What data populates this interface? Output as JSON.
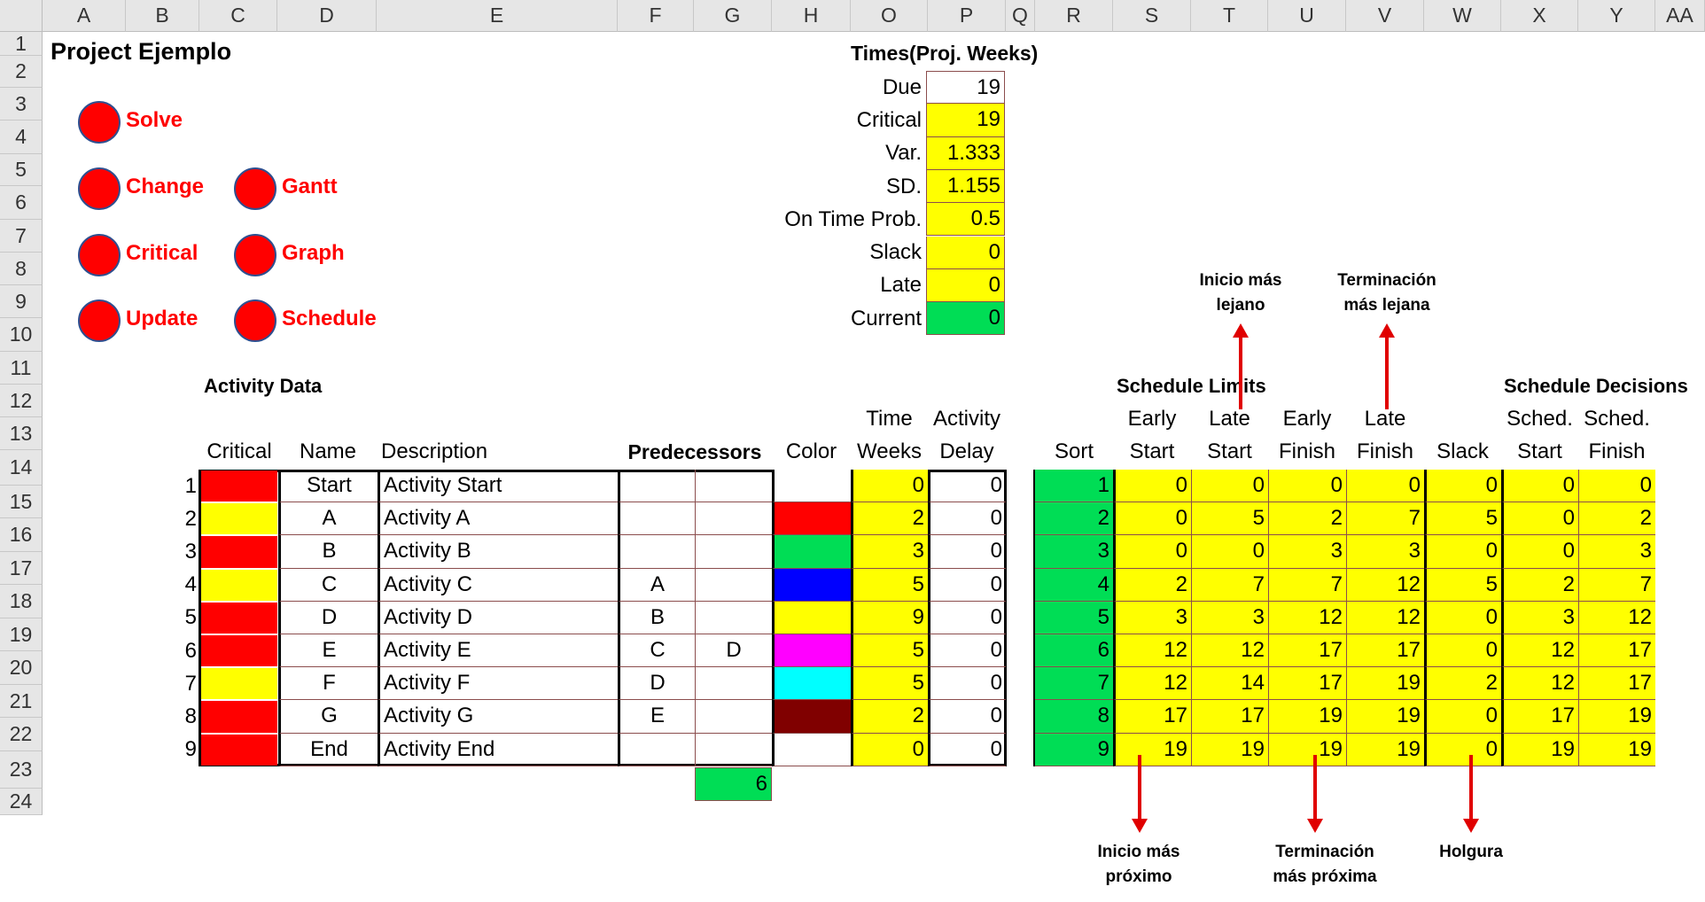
{
  "columns": [
    "A",
    "B",
    "C",
    "D",
    "E",
    "F",
    "G",
    "H",
    "O",
    "P",
    "Q",
    "R",
    "S",
    "T",
    "U",
    "V",
    "W",
    "X",
    "Y",
    "AA"
  ],
  "rows": [
    "1",
    "2",
    "3",
    "4",
    "5",
    "6",
    "7",
    "8",
    "9",
    "10",
    "11",
    "12",
    "13",
    "14",
    "15",
    "16",
    "17",
    "18",
    "19",
    "20",
    "21",
    "22",
    "23",
    "24"
  ],
  "title": "Project Ejemplo",
  "buttons": [
    "Solve",
    "Change",
    "Gantt",
    "Critical",
    "Graph",
    "Update",
    "Schedule"
  ],
  "times": {
    "header": "Times(Proj. Weeks)",
    "labels": [
      "Due",
      "Critical",
      "Var.",
      "SD.",
      "On Time Prob.",
      "Slack",
      "Late",
      "Current"
    ],
    "values": [
      "19",
      "19",
      "1.333",
      "1.155",
      "0.5",
      "0",
      "0",
      "0"
    ]
  },
  "activity": {
    "section": "Activity Data",
    "h_critical": "Critical",
    "h_name": "Name",
    "h_desc": "Description",
    "h_pred": "Predecessors",
    "h_color": "Color",
    "h_time1": "Time",
    "h_time2": "Weeks",
    "h_delay1": "Activity",
    "h_delay2": "Delay",
    "rows": [
      {
        "num": "1",
        "name": "Start",
        "desc": "Activity Start",
        "p1": "",
        "p2": "",
        "time": "0",
        "delay": "0"
      },
      {
        "num": "2",
        "name": "A",
        "desc": "Activity A",
        "p1": "",
        "p2": "",
        "time": "2",
        "delay": "0"
      },
      {
        "num": "3",
        "name": "B",
        "desc": "Activity B",
        "p1": "",
        "p2": "",
        "time": "3",
        "delay": "0"
      },
      {
        "num": "4",
        "name": "C",
        "desc": "Activity C",
        "p1": "A",
        "p2": "",
        "time": "5",
        "delay": "0"
      },
      {
        "num": "5",
        "name": "D",
        "desc": "Activity D",
        "p1": "B",
        "p2": "",
        "time": "9",
        "delay": "0"
      },
      {
        "num": "6",
        "name": "E",
        "desc": "Activity E",
        "p1": "C",
        "p2": "D",
        "time": "5",
        "delay": "0"
      },
      {
        "num": "7",
        "name": "F",
        "desc": "Activity F",
        "p1": "D",
        "p2": "",
        "time": "5",
        "delay": "0"
      },
      {
        "num": "8",
        "name": "G",
        "desc": "Activity G",
        "p1": "E",
        "p2": "",
        "time": "2",
        "delay": "0"
      },
      {
        "num": "9",
        "name": "End",
        "desc": "Activity End",
        "p1": "",
        "p2": "",
        "time": "0",
        "delay": "0"
      }
    ],
    "critical_colors": [
      "#ff0000",
      "#ffff00",
      "#ff0000",
      "#ffff00",
      "#ff0000",
      "#ff0000",
      "#ffff00",
      "#ff0000",
      "#ff0000"
    ],
    "activity_colors": [
      "#ffffff",
      "#ff0000",
      "#00dd55",
      "#0000ff",
      "#ffff00",
      "#ff00ff",
      "#00ffff",
      "#800000",
      "#ffffff"
    ],
    "g23": "6"
  },
  "schedule": {
    "limits_title": "Schedule Limits",
    "decisions_title": "Schedule Decisions",
    "h_sort": "Sort",
    "h_es1": "Early",
    "h_es2": "Start",
    "h_ls1": "Late",
    "h_ls2": "Start",
    "h_ef1": "Early",
    "h_ef2": "Finish",
    "h_lf1": "Late",
    "h_lf2": "Finish",
    "h_slack": "Slack",
    "h_ss1": "Sched.",
    "h_ss2": "Start",
    "h_sf1": "Sched.",
    "h_sf2": "Finish",
    "rows": [
      {
        "sort": "1",
        "es": "0",
        "ls": "0",
        "ef": "0",
        "lf": "0",
        "slack": "0",
        "ss": "0",
        "sf": "0"
      },
      {
        "sort": "2",
        "es": "0",
        "ls": "5",
        "ef": "2",
        "lf": "7",
        "slack": "5",
        "ss": "0",
        "sf": "2"
      },
      {
        "sort": "3",
        "es": "0",
        "ls": "0",
        "ef": "3",
        "lf": "3",
        "slack": "0",
        "ss": "0",
        "sf": "3"
      },
      {
        "sort": "4",
        "es": "2",
        "ls": "7",
        "ef": "7",
        "lf": "12",
        "slack": "5",
        "ss": "2",
        "sf": "7"
      },
      {
        "sort": "5",
        "es": "3",
        "ls": "3",
        "ef": "12",
        "lf": "12",
        "slack": "0",
        "ss": "3",
        "sf": "12"
      },
      {
        "sort": "6",
        "es": "12",
        "ls": "12",
        "ef": "17",
        "lf": "17",
        "slack": "0",
        "ss": "12",
        "sf": "17"
      },
      {
        "sort": "7",
        "es": "12",
        "ls": "14",
        "ef": "17",
        "lf": "19",
        "slack": "2",
        "ss": "12",
        "sf": "17"
      },
      {
        "sort": "8",
        "es": "17",
        "ls": "17",
        "ef": "19",
        "lf": "19",
        "slack": "0",
        "ss": "17",
        "sf": "19"
      },
      {
        "sort": "9",
        "es": "19",
        "ls": "19",
        "ef": "19",
        "lf": "19",
        "slack": "0",
        "ss": "19",
        "sf": "19"
      }
    ]
  },
  "annotations": {
    "inicio_lejano": [
      "Inicio más",
      "lejano"
    ],
    "term_lejana": [
      "Terminación",
      "más lejana"
    ],
    "inicio_proximo": [
      "Inicio más",
      "próximo"
    ],
    "term_proxima": [
      "Terminación",
      "más próxima"
    ],
    "holgura": [
      "Holgura"
    ]
  },
  "colors": {
    "red": "#ff0000",
    "yellow": "#ffff00",
    "green": "#00dd55",
    "arrow": "#e00000"
  }
}
